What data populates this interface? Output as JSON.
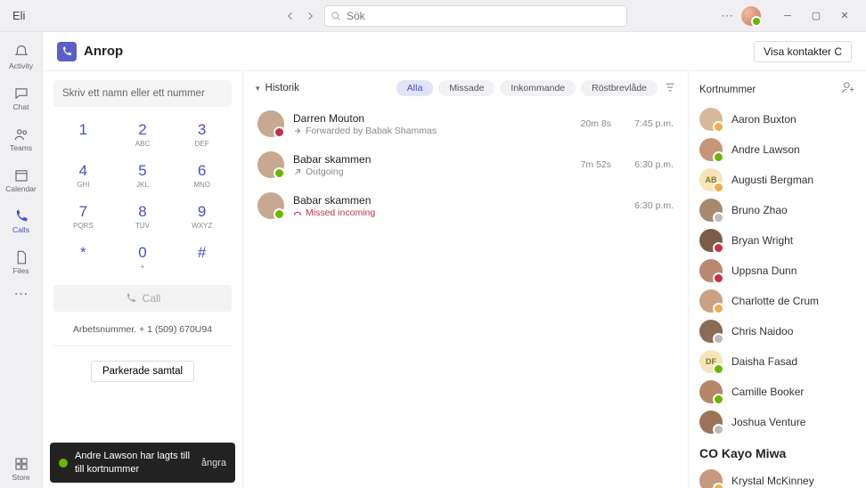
{
  "titlebar": {
    "app_title": "Eli",
    "search_placeholder": "Sök"
  },
  "rail": {
    "activity": "Activity",
    "chat": "Chat",
    "teams": "Teams",
    "calendar": "Calendar",
    "calls": "Calls",
    "files": "Files",
    "store": "Store"
  },
  "header": {
    "title": "Anrop",
    "contacts_btn": "Visa kontakter C"
  },
  "dialer": {
    "input_placeholder": "Skriv ett namn eller ett nummer",
    "keys": [
      {
        "d": "1",
        "l": ""
      },
      {
        "d": "2",
        "l": "ABC"
      },
      {
        "d": "3",
        "l": "DEF"
      },
      {
        "d": "4",
        "l": "GHI"
      },
      {
        "d": "5",
        "l": "JKL"
      },
      {
        "d": "6",
        "l": "MNO"
      },
      {
        "d": "7",
        "l": "PQRS"
      },
      {
        "d": "8",
        "l": "TUV"
      },
      {
        "d": "9",
        "l": "WXYZ"
      },
      {
        "d": "*",
        "l": ""
      },
      {
        "d": "0",
        "l": "+"
      },
      {
        "d": "#",
        "l": ""
      }
    ],
    "call_label": "Call",
    "work_number": "Arbetsnummer. + 1 (509) 670U94",
    "parked_label": "Parkerade samtal"
  },
  "toast": {
    "message": "Andre Lawson har lagts till till kortnummer",
    "undo": "ångra"
  },
  "history": {
    "title": "Historik",
    "filters": {
      "all": "Alla",
      "missed": "Missade",
      "incoming": "Inkommande",
      "voicemail": "Röstbrevlåde"
    },
    "items": [
      {
        "name": "Darren Mouton",
        "sub": "Forwarded by Babak Shammas",
        "type": "forwarded",
        "duration": "20m 8s",
        "time": "7:45 p.m."
      },
      {
        "name": "Babar skammen",
        "sub": "Outgoing",
        "type": "outgoing",
        "duration": "7m 52s",
        "time": "6:30 p.m."
      },
      {
        "name": "Babar skammen",
        "sub": "Missed incoming",
        "type": "missed",
        "duration": "",
        "time": "6:30 p.m."
      }
    ]
  },
  "speed": {
    "title": "Kortnummer",
    "contacts": [
      {
        "name": "Aaron Buxton",
        "status": "away",
        "bg": "#d8b89a"
      },
      {
        "name": "Andre Lawson",
        "status": "avail",
        "bg": "#c79578"
      },
      {
        "name": "Augusti Bergman",
        "status": "away",
        "bg": "#f6e5b8",
        "initials": "AB"
      },
      {
        "name": "Bruno Zhao",
        "status": "off",
        "bg": "#a8896e"
      },
      {
        "name": "Bryan Wright",
        "status": "busy",
        "bg": "#7a5c48"
      },
      {
        "name": "Uppsna Dunn",
        "status": "busy",
        "bg": "#b88970"
      },
      {
        "name": "Charlotte de Crum",
        "status": "away",
        "bg": "#c9a185"
      },
      {
        "name": "Chris Naidoo",
        "status": "off",
        "bg": "#8a6b54"
      },
      {
        "name": "Daisha Fasad",
        "status": "avail",
        "bg": "#f6e5b8",
        "initials": "DF"
      },
      {
        "name": "Camille Booker",
        "status": "avail",
        "bg": "#b5876a"
      },
      {
        "name": "Joshua Venture",
        "status": "off",
        "bg": "#9d7358"
      }
    ],
    "group_label": "CO Kayo Miwa",
    "group_contacts": [
      {
        "name": "Krystal McKinney",
        "status": "away",
        "bg": "#c59a7e"
      }
    ]
  }
}
